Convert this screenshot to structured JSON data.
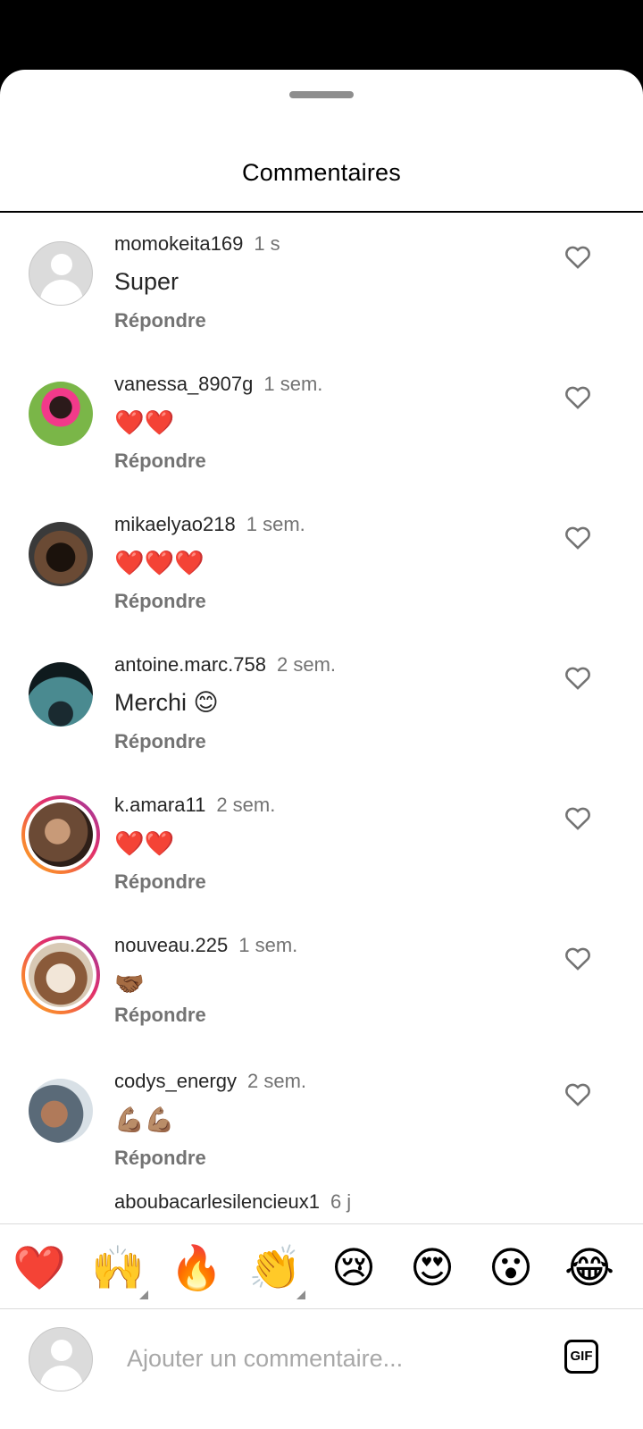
{
  "sheet": {
    "title": "Commentaires"
  },
  "reply_label": "Répondre",
  "comments": [
    {
      "username": "momokeita169",
      "time": "1 s",
      "text": "Super",
      "avatar": "default"
    },
    {
      "username": "vanessa_8907g",
      "time": "1 sem.",
      "text": "❤️❤️",
      "avatar": "photo"
    },
    {
      "username": "mikaelyao218",
      "time": "1 sem.",
      "text": "❤️❤️❤️",
      "avatar": "photo"
    },
    {
      "username": "antoine.marc.758",
      "time": "2 sem.",
      "text": "Merchi 😊",
      "avatar": "photo"
    },
    {
      "username": "k.amara11",
      "time": "2 sem.",
      "text": "❤️❤️",
      "avatar": "photo-story"
    },
    {
      "username": "nouveau.225",
      "time": "1 sem.",
      "text": "🤝🏾",
      "avatar": "photo-story"
    },
    {
      "username": "codys_energy",
      "time": "2 sem.",
      "text": "💪🏽💪🏽",
      "avatar": "photo"
    },
    {
      "username": "aboubacarlesilencieux1",
      "time": "6 j"
    }
  ],
  "emoji_bar": [
    "❤️",
    "🙌",
    "🔥",
    "👏",
    "😢",
    "😍",
    "😮",
    "😂"
  ],
  "input": {
    "placeholder": "Ajouter un commentaire..."
  },
  "gif_label": "GIF",
  "colors": {
    "secondary_text": "#737373",
    "primary_text": "#262626",
    "story_ring_start": "#f9a825",
    "story_ring_end": "#c13584"
  }
}
